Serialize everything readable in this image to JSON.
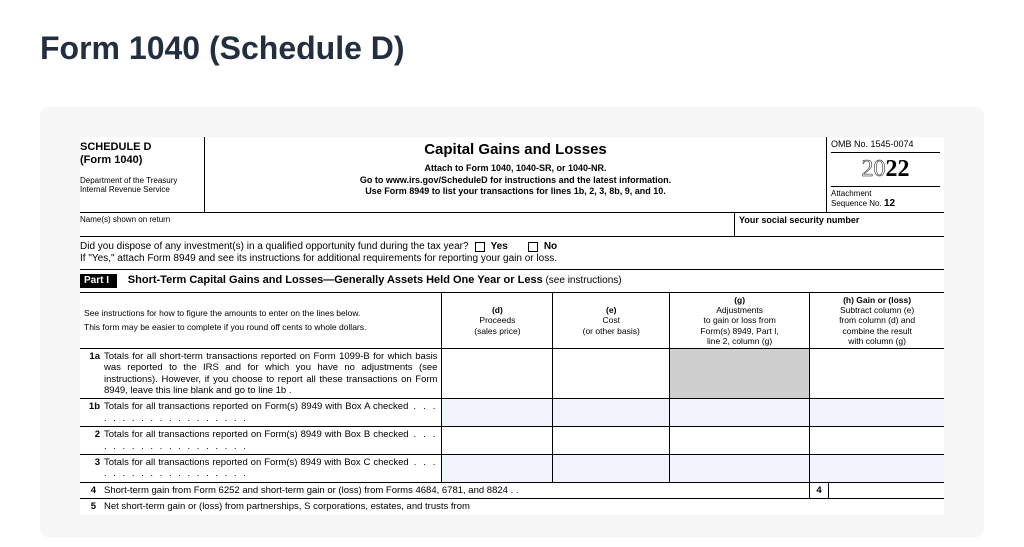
{
  "page": {
    "title": "Form 1040 (Schedule D)"
  },
  "form": {
    "header": {
      "schedule": "SCHEDULE D",
      "form_ref": "(Form 1040)",
      "dept": "Department of the Treasury",
      "irs": "Internal Revenue Service",
      "title": "Capital Gains and Losses",
      "attach": "Attach to Form 1040, 1040-SR, or 1040-NR.",
      "goto": "Go to www.irs.gov/ScheduleD for instructions and the latest information.",
      "use8949": "Use Form 8949 to list your transactions for lines 1b, 2, 3, 8b, 9, and 10.",
      "omb": "OMB No. 1545-0074",
      "year_prefix": "20",
      "year_suffix": "22",
      "attachment": "Attachment",
      "seq": "Sequence No.",
      "seq_num": "12"
    },
    "name_row": {
      "label": "Name(s) shown on return",
      "ssn": "Your social security number"
    },
    "qof": {
      "q": "Did you dispose of any investment(s) in a qualified opportunity fund during the tax year?",
      "yes": "Yes",
      "no": "No",
      "note": "If \"Yes,\" attach Form 8949 and see its instructions for additional requirements for reporting your gain or loss."
    },
    "part1": {
      "badge": "Part I",
      "title": "Short-Term Capital Gains and Losses—Generally Assets Held One Year or Less",
      "note": "(see instructions)"
    },
    "columns": {
      "instr1": "See instructions for how to figure the amounts to enter on the lines below.",
      "instr2": "This form may be easier to complete if you round off cents to whole dollars.",
      "d": "(d)\nProceeds\n(sales price)",
      "e": "(e)\nCost\n(or other basis)",
      "g": "(g)\nAdjustments\nto gain or loss from\nForm(s) 8949, Part I,\nline 2, column (g)",
      "h": "(h) Gain or (loss)\nSubtract column (e)\nfrom column (d) and\ncombine the result\nwith column (g)"
    },
    "rows": {
      "r1a_num": "1a",
      "r1a": "Totals for all short-term transactions reported on Form 1099-B for which basis was reported to the IRS and for which you have no adjustments (see instructions). However, if you choose to report all these transactions on Form 8949, leave this line blank and go to line 1b   .",
      "r1b_num": "1b",
      "r1b": "Totals for all transactions reported on Form(s) 8949 with Box A checked",
      "r2_num": "2",
      "r2": "Totals for all transactions reported on Form(s) 8949 with Box B checked",
      "r3_num": "3",
      "r3": "Totals for all transactions reported on Form(s) 8949 with Box C checked",
      "r4_num": "4",
      "r4": "Short-term gain from Form 6252 and short-term gain or (loss) from Forms 4684, 6781, and 8824    .    .",
      "r4_box": "4",
      "r5_num": "5",
      "r5": "Net  short-term  gain  or  (loss)  from  partnerships,  S  corporations,  estates,  and  trusts  from"
    }
  }
}
